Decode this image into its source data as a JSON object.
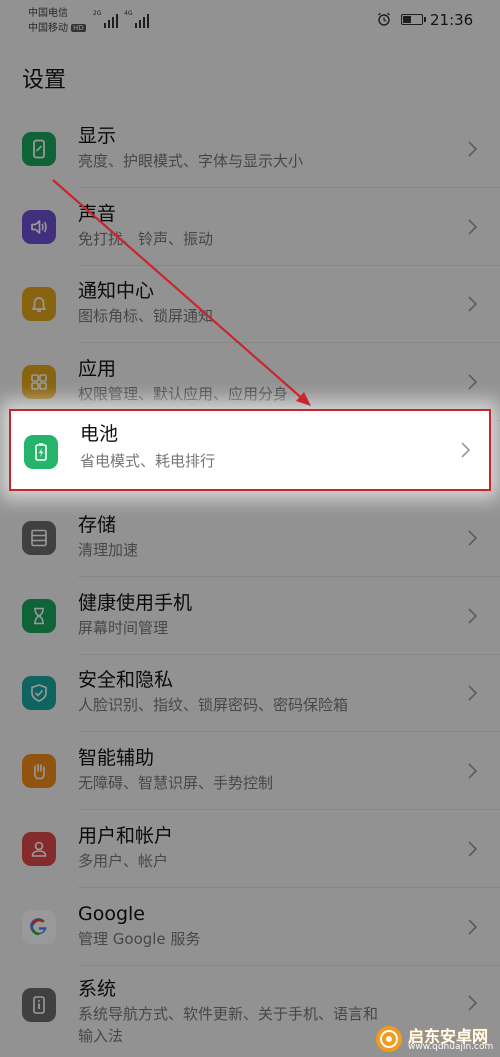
{
  "status_bar": {
    "carrier_1": "中国电信",
    "carrier_2": "中国移动",
    "carrier_2_badge": "HD",
    "signal_1_label": "2G",
    "signal_2_label": "4G",
    "time": "21:36"
  },
  "page_title": "设置",
  "settings": [
    {
      "label": "显示",
      "subtitle": "亮度、护眼模式、字体与显示大小",
      "icon": "display-phone-icon",
      "color": "#1aa55a"
    },
    {
      "label": "声音",
      "subtitle": "免打扰、铃声、振动",
      "icon": "speaker-icon",
      "color": "#6b4fd0"
    },
    {
      "label": "通知中心",
      "subtitle": "图标角标、锁屏通知",
      "icon": "bell-icon",
      "color": "#e3a51c"
    },
    {
      "label": "应用",
      "subtitle": "权限管理、默认应用、应用分身",
      "icon": "apps-grid-icon",
      "color": "#e3a51c"
    },
    {
      "label": "电池",
      "subtitle": "省电模式、耗电排行",
      "icon": "battery-icon",
      "color": "#25b46a"
    },
    {
      "label": "存储",
      "subtitle": "清理加速",
      "icon": "storage-icon",
      "color": "#6c6c6c"
    },
    {
      "label": "健康使用手机",
      "subtitle": "屏幕时间管理",
      "icon": "hourglass-icon",
      "color": "#1aa55a"
    },
    {
      "label": "安全和隐私",
      "subtitle": "人脸识别、指纹、锁屏密码、密码保险箱",
      "icon": "shield-icon",
      "color": "#1aa5a0"
    },
    {
      "label": "智能辅助",
      "subtitle": "无障碍、智慧识屏、手势控制",
      "icon": "hand-icon",
      "color": "#f08a1c"
    },
    {
      "label": "用户和帐户",
      "subtitle": "多用户、帐户",
      "icon": "user-icon",
      "color": "#e04848"
    },
    {
      "label": "Google",
      "subtitle": "管理 Google 服务",
      "icon": "google-icon",
      "color": "#ffffff"
    },
    {
      "label": "系统",
      "subtitle": "系统导航方式、软件更新、关于手机、语言和",
      "subtitle_line2": "输入法",
      "icon": "info-icon",
      "color": "#6c6c6c"
    }
  ],
  "highlight": {
    "index": 4,
    "border_color": "#c9252c"
  },
  "watermark": {
    "name": "启东安卓网",
    "url": "www.qdhuajin.com"
  }
}
